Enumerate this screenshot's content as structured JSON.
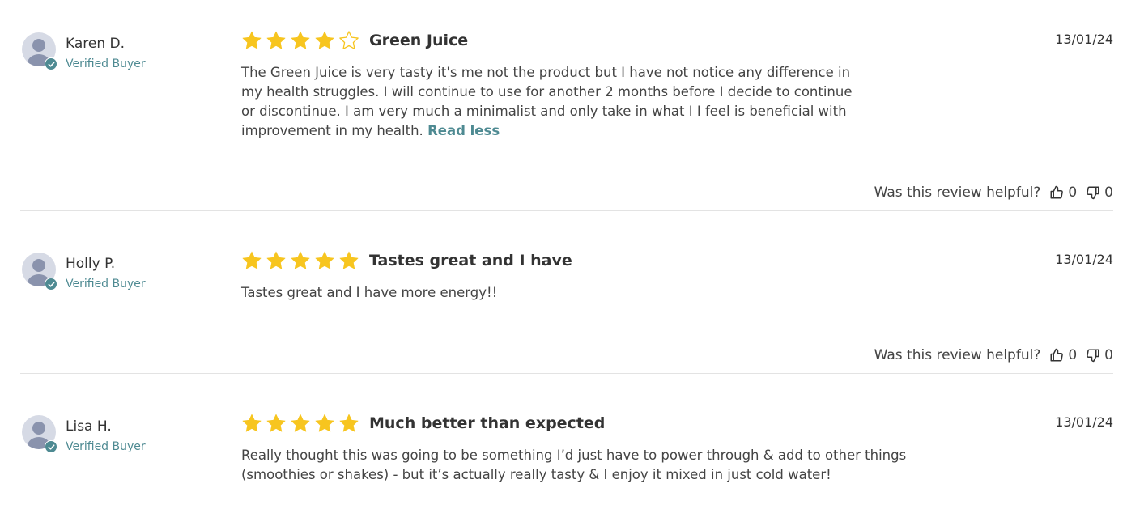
{
  "colors": {
    "star": "#f7c51f",
    "accent": "#4e8a92",
    "text": "#333333",
    "divider": "#e3e3e3"
  },
  "icons": {
    "avatar": "user-avatar-icon",
    "verified": "check-badge-icon",
    "thumbs_up": "thumbs-up-icon",
    "thumbs_down": "thumbs-down-icon",
    "star": "star-icon"
  },
  "helpful_label": "Was this review helpful?",
  "reviews": [
    {
      "author": "Karen D.",
      "verified_label": "Verified Buyer",
      "rating": 4,
      "max_rating": 5,
      "title": "Green Juice",
      "date": "13/01/24",
      "body": "The Green Juice is very tasty it's me not the product but I have not notice any difference in my health struggles. I will continue to use for another 2 months before I decide to continue or discontinue. I am very much a minimalist and only take in what I I feel is beneficial with improvement in my health.",
      "read_less_label": "Read less",
      "helpful_up": "0",
      "helpful_down": "0"
    },
    {
      "author": "Holly P.",
      "verified_label": "Verified Buyer",
      "rating": 5,
      "max_rating": 5,
      "title": "Tastes great and I have",
      "date": "13/01/24",
      "body": "Tastes great and I have more energy!!",
      "helpful_up": "0",
      "helpful_down": "0"
    },
    {
      "author": "Lisa H.",
      "verified_label": "Verified Buyer",
      "rating": 5,
      "max_rating": 5,
      "title": "Much better than expected",
      "date": "13/01/24",
      "body": "Really thought this was going to be something I’d just have to power through & add to other things (smoothies or shakes) - but it’s actually really tasty & I enjoy it mixed in just cold water!"
    }
  ]
}
